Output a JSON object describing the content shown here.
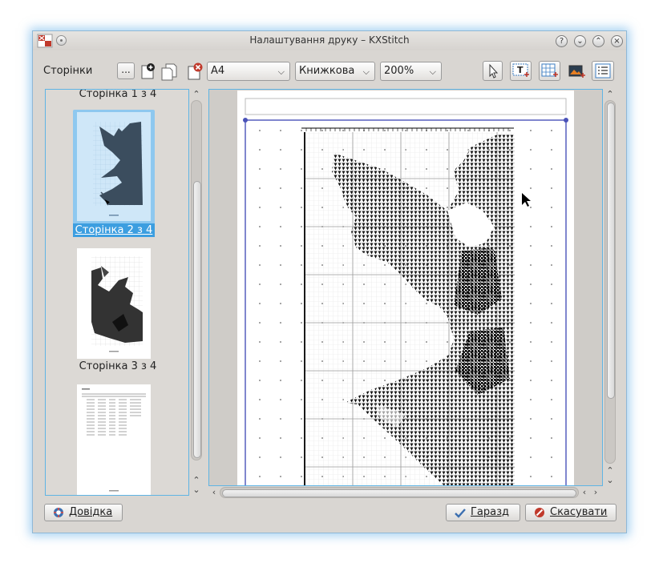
{
  "window": {
    "title": "Налаштування друку – KXStitch"
  },
  "toolbar": {
    "label": "Сторінки",
    "more_button": "...",
    "paper_size": "A4",
    "orientation": "Книжкова",
    "zoom": "200%"
  },
  "pages": {
    "captions": [
      "Сторінка 1 з 4",
      "Сторінка 2 з 4",
      "Сторінка 3 з 4"
    ],
    "selected_index": 1
  },
  "buttons": {
    "help": "Довідка",
    "ok": "Гаразд",
    "cancel": "Скасувати"
  },
  "colors": {
    "focus": "#5fb4e4",
    "selection": "#3c9ee0",
    "window_bg": "#d9d6d2"
  }
}
